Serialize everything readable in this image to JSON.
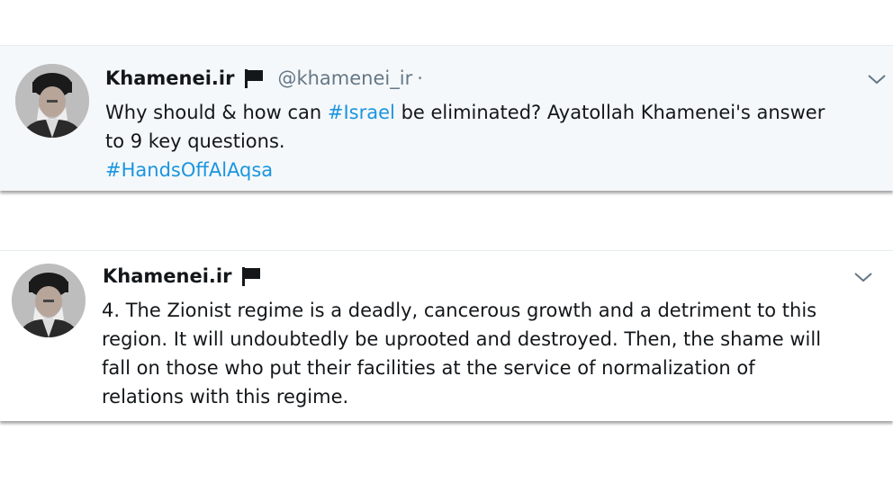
{
  "colors": {
    "link": "#1b95e0",
    "text": "#14171a",
    "secondary": "#657786",
    "tweet1_background": "#f5f8fa",
    "tweet2_background": "#ffffff"
  },
  "tweets": [
    {
      "name": "Khamenei.ir",
      "badge_icon": "flag-icon",
      "handle": "@khamenei_ir",
      "separator": "·",
      "menu_icon": "chevron-down-icon",
      "text_part1": "Why should & how can ",
      "hashtag1": "#Israel",
      "text_part2": " be eliminated? Ayatollah Khamenei's answer",
      "text_line2": "to 9 key questions.",
      "hashtag2": "#HandsOffAlAqsa"
    },
    {
      "name": "Khamenei.ir",
      "badge_icon": "flag-icon",
      "menu_icon": "chevron-down-icon",
      "lines": [
        "4. The Zionist regime is a deadly, cancerous growth and a detriment to this",
        "region. It will undoubtedly be uprooted and destroyed. Then, the shame will",
        "fall on those who put their facilities at the service of normalization of",
        "relations with this regime."
      ]
    }
  ]
}
